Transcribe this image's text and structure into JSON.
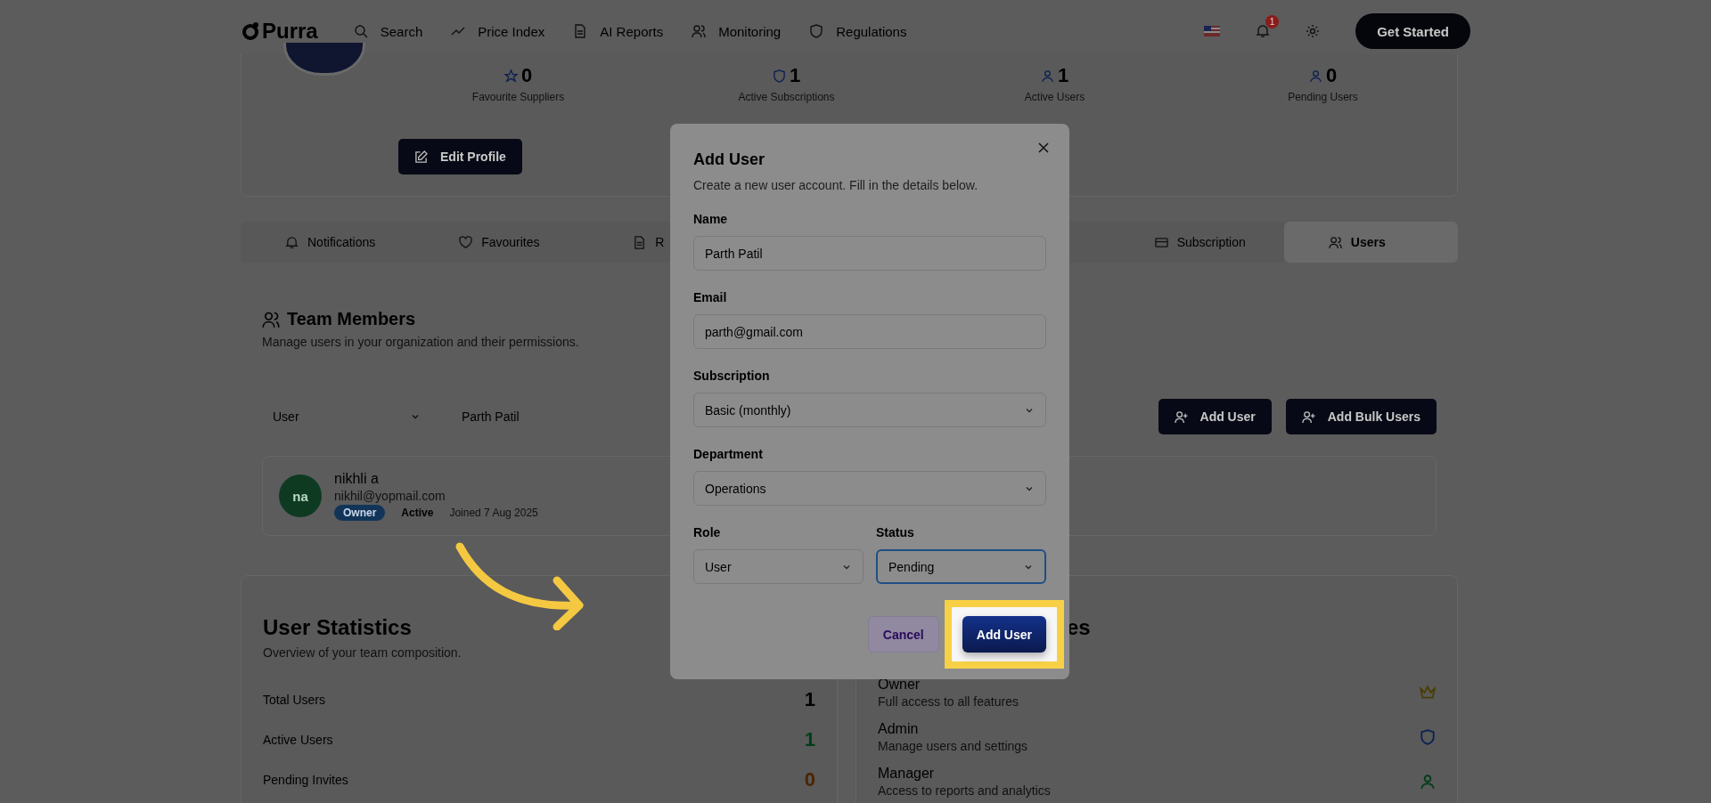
{
  "nav": {
    "logo": "Purra",
    "items": [
      {
        "label": "Search"
      },
      {
        "label": "Price Index"
      },
      {
        "label": "AI Reports"
      },
      {
        "label": "Monitoring"
      },
      {
        "label": "Regulations"
      }
    ],
    "notification_count": "1",
    "cta": "Get Started"
  },
  "profile": {
    "stats": [
      {
        "value": "0",
        "label": "Favourite Suppliers"
      },
      {
        "value": "1",
        "label": "Active Subscriptions"
      },
      {
        "value": "1",
        "label": "Active Users"
      },
      {
        "value": "0",
        "label": "Pending Users"
      }
    ],
    "edit_button": "Edit Profile"
  },
  "tabs": [
    {
      "label": "Notifications",
      "selected": false
    },
    {
      "label": "Favourites",
      "selected": false
    },
    {
      "label": "R",
      "selected": false
    },
    {
      "label": "Subscription",
      "selected": false
    },
    {
      "label": "Users",
      "selected": true
    }
  ],
  "team": {
    "title": "Team Members",
    "subtitle": "Manage users in your organization and their permissions.",
    "role_filter": "User",
    "search_value": "Parth Patil",
    "buttons": [
      "Add User",
      "Add Bulk Users"
    ],
    "members": [
      {
        "initials": "na",
        "name": "nikhli a",
        "email": "nikhil@yopmail.com",
        "role": "Owner",
        "status": "Active",
        "joined": "Joined 7 Aug 2025"
      }
    ]
  },
  "user_statistics": {
    "title": "User Statistics",
    "subtitle": "Overview of your team composition.",
    "rows": [
      {
        "label": "Total Users",
        "value": "1",
        "color": "#000000"
      },
      {
        "label": "Active Users",
        "value": "1",
        "color": "#003d1a"
      },
      {
        "label": "Pending Invites",
        "value": "0",
        "color": "#4a2500"
      }
    ]
  },
  "roles_card": {
    "title": "es",
    "roles": [
      {
        "name": "Owner",
        "description": "Full access to all features",
        "color": "#4a3d00"
      },
      {
        "name": "Admin",
        "description": "Manage users and settings",
        "color": "#0a2050"
      },
      {
        "name": "Manager",
        "description": "Access to reports and analytics",
        "color": "#003d1a"
      }
    ]
  },
  "dialog": {
    "title": "Add User",
    "description": "Create a new user account. Fill in the details below.",
    "fields": [
      {
        "label": "Name",
        "kind": "text",
        "value": "Parth Patil",
        "focused": false
      },
      {
        "label": "Email",
        "kind": "text",
        "value": "parth@gmail.com",
        "focused": false
      },
      {
        "label": "Subscription",
        "kind": "select",
        "value": "Basic (monthly)",
        "focused": false
      },
      {
        "label": "Department",
        "kind": "select",
        "value": "Operations",
        "focused": false
      }
    ],
    "row_fields": [
      {
        "label": "Role",
        "kind": "select",
        "value": "User",
        "focused": false
      },
      {
        "label": "Status",
        "kind": "select",
        "value": "Pending",
        "focused": true
      }
    ],
    "cancel": "Cancel",
    "submit": {
      "label": "Add User",
      "highlighted": true
    }
  }
}
